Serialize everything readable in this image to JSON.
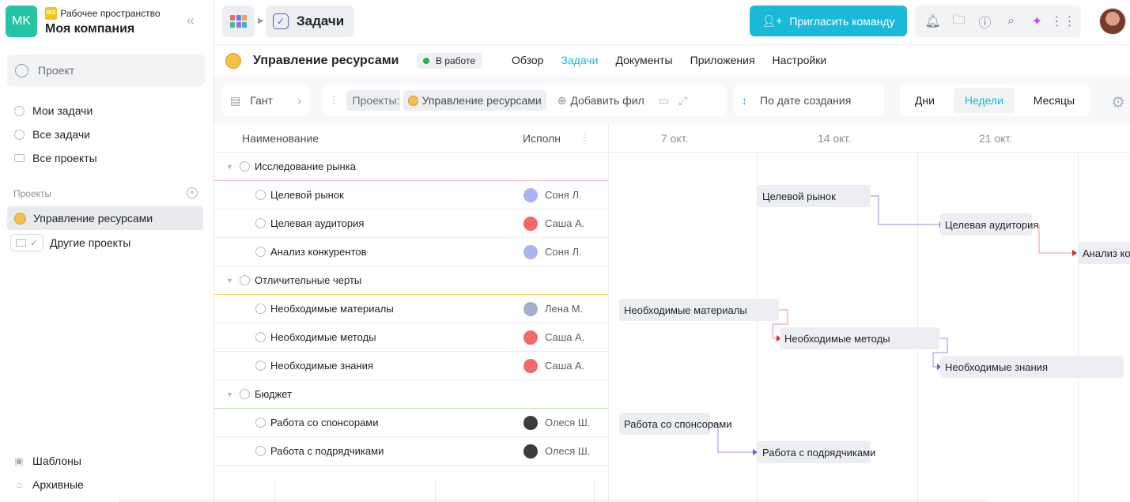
{
  "workspace": {
    "initials": "MK",
    "badge": "BIZ",
    "label": "Рабочее пространство",
    "name": "Моя компания"
  },
  "sidebar": {
    "search_placeholder": "Проект",
    "items": [
      {
        "label": "Мои задачи"
      },
      {
        "label": "Все задачи"
      },
      {
        "label": "Все проекты"
      }
    ],
    "projects_title": "Проекты",
    "active_project": "Управление ресурсами",
    "other_projects": "Другие проекты",
    "bottom": [
      {
        "label": "Шаблоны"
      },
      {
        "label": "Архивные"
      }
    ]
  },
  "topbar": {
    "section": "Задачи",
    "invite": "Пригласить команду"
  },
  "project": {
    "title": "Управление ресурсами",
    "status": "В работе",
    "tabs": [
      "Обзор",
      "Задачи",
      "Документы",
      "Приложения",
      "Настройки"
    ],
    "active_tab": "Задачи"
  },
  "toolbar": {
    "view": "Гант",
    "projects_label": "Проекты:",
    "project_chip": "Управление ресурсами",
    "add_filter": "Добавить фил",
    "sort": "По дате создания",
    "scales": [
      "Дни",
      "Недели",
      "Месяцы"
    ],
    "active_scale": "Недели"
  },
  "table": {
    "col_name": "Наименование",
    "col_exec": "Исполн",
    "rows": [
      {
        "type": "group",
        "name": "Исследование рынка",
        "color": "#e9b7b3"
      },
      {
        "type": "task",
        "name": "Целевой рынок",
        "exec": "Соня Л.",
        "ava": "#aab4f3"
      },
      {
        "type": "task",
        "name": "Целевая аудитория",
        "exec": "Саша А.",
        "ava": "#f06a6a"
      },
      {
        "type": "task",
        "name": "Анализ конкурентов",
        "exec": "Соня Л.",
        "ava": "#aab4f3"
      },
      {
        "type": "group",
        "name": "Отличительные черты",
        "color": "#f0d36b"
      },
      {
        "type": "task",
        "name": "Необходимые материалы",
        "exec": "Лена М.",
        "ava": "#9fb0c8"
      },
      {
        "type": "task",
        "name": "Необходимые методы",
        "exec": "Саша А.",
        "ava": "#f06a6a"
      },
      {
        "type": "task",
        "name": "Необходимые знания",
        "exec": "Саша А.",
        "ava": "#f06a6a"
      },
      {
        "type": "group",
        "name": "Бюджет",
        "color": "#bfe0ae"
      },
      {
        "type": "task",
        "name": "Работа со спонсорами",
        "exec": "Олеся Ш.",
        "ava": "#3c3c3c"
      },
      {
        "type": "task",
        "name": "Работа с подрядчиками",
        "exec": "Олеся Ш.",
        "ava": "#3c3c3c"
      }
    ]
  },
  "gantt": {
    "weeks": [
      "7 окт.",
      "14 окт.",
      "21 окт."
    ],
    "bars": [
      {
        "name": "Целевой рынок"
      },
      {
        "name": "Целевая аудитория"
      },
      {
        "name": "Анализ ко"
      },
      {
        "name": "Необходимые материалы"
      },
      {
        "name": "Необходимые методы"
      },
      {
        "name": "Необходимые знания"
      },
      {
        "name": "Работа со спонсорами"
      },
      {
        "name": "Работа с подрядчиками"
      }
    ]
  }
}
